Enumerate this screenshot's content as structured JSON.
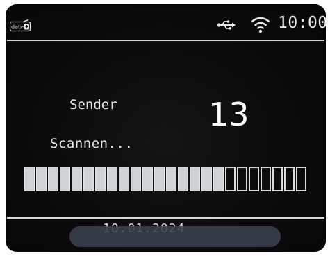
{
  "status_bar": {
    "source_icon": "dab-plus-icon",
    "source_label": "dab+",
    "usb_icon": "usb-icon",
    "wifi_icon": "wifi-icon",
    "clock": "10:00"
  },
  "scan": {
    "station_label": "Sender",
    "station_count": "13",
    "status_label": "Scannen...",
    "progress": {
      "filled_segments": 17,
      "total_segments": 24
    }
  },
  "footer": {
    "date_text": "10.01.2024"
  },
  "colors": {
    "screen_bg": "#0b0b0b",
    "text": "#e6e9ec",
    "segment_fill": "#cfd3d5",
    "divider": "#d6d9db"
  }
}
